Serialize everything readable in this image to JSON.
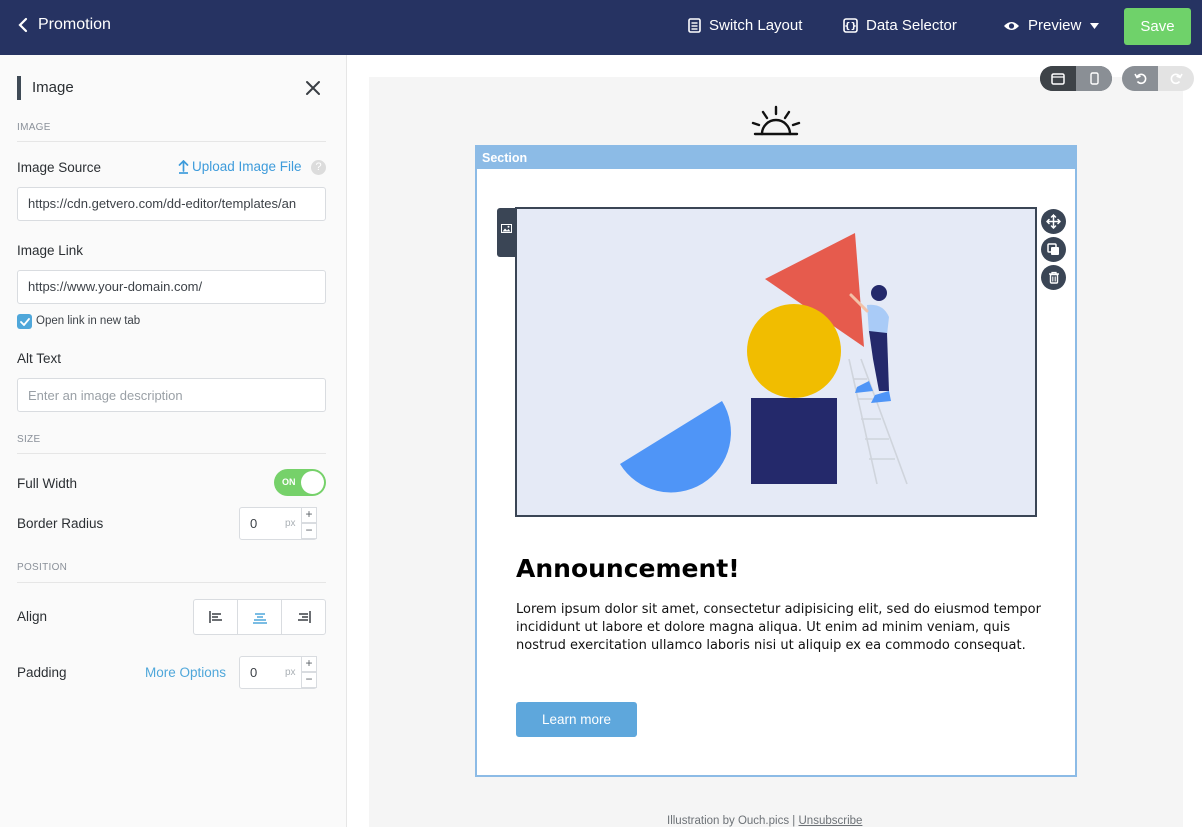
{
  "topbar": {
    "back_label": "Promotion",
    "switch_layout_label": "Switch Layout",
    "data_selector_label": "Data Selector",
    "preview_label": "Preview",
    "save_label": "Save"
  },
  "panel": {
    "title": "Image",
    "sections": {
      "image": "IMAGE",
      "size": "SIZE",
      "position": "POSITION"
    },
    "image_source": {
      "label": "Image Source",
      "upload_label": "Upload Image File",
      "help": "?",
      "value": "https://cdn.getvero.com/dd-editor/templates/an"
    },
    "image_link": {
      "label": "Image Link",
      "value": "https://www.your-domain.com/"
    },
    "open_new_tab": {
      "label": "Open link in new tab",
      "checked": true
    },
    "alt_text": {
      "label": "Alt Text",
      "placeholder": "Enter an image description"
    },
    "full_width": {
      "label": "Full Width",
      "state_label": "ON"
    },
    "border_radius": {
      "label": "Border Radius",
      "value": "0",
      "unit": "px"
    },
    "align": {
      "label": "Align",
      "selected": "center"
    },
    "padding": {
      "label": "Padding",
      "more_options": "More Options",
      "value": "0",
      "unit": "px"
    },
    "stepper_plus": "+",
    "stepper_minus": "−"
  },
  "canvas": {
    "section_label": "Section",
    "heading": "Announcement!",
    "body": "Lorem ipsum dolor sit amet, consectetur adipisicing elit, sed do eiusmod tempor incididunt ut labore et dolore magna aliqua. Ut enim ad minim veniam, quis nostrud exercitation ullamco laboris nisi ut aliquip ex ea commodo consequat.",
    "button_label": "Learn more",
    "footer_credit": "Illustration by Ouch.pics",
    "footer_separator": "|",
    "footer_unsubscribe": "Unsubscribe"
  },
  "colors": {
    "topbar": "#263362",
    "save": "#6fd26a",
    "accent": "#4fa7da",
    "section": "#8cbbe6",
    "cta": "#5ea7dc"
  }
}
